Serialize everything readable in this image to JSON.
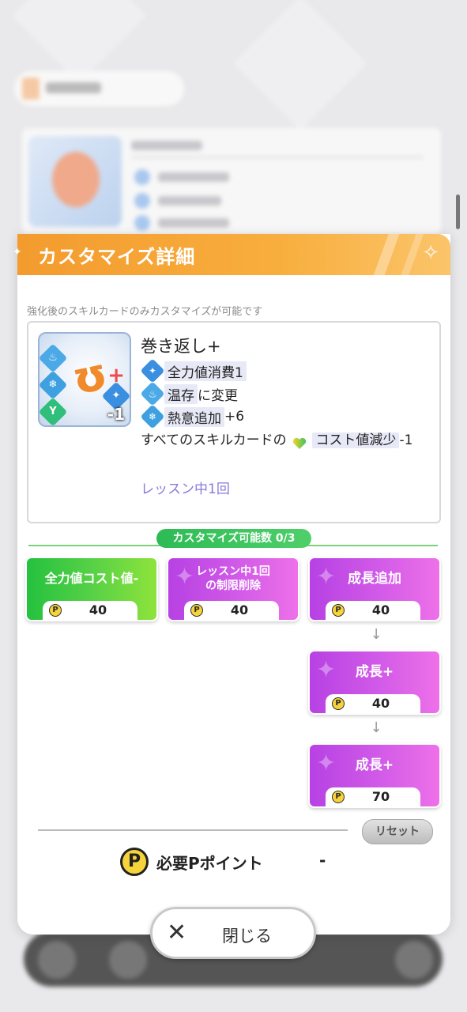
{
  "modal": {
    "title": "カスタマイズ詳細",
    "hint": "強化後のスキルカードのみカスタマイズが可能です",
    "card": {
      "name": "巻き返し+",
      "thumb_cost": "-1",
      "effects": [
        {
          "icon": "blue-diamond-icon",
          "text": "全力値消費1"
        },
        {
          "icon": "onsen-retain-icon",
          "text_highlight": "温存",
          "text_rest": "に変更"
        },
        {
          "icon": "heat-snowflake-icon",
          "text_highlight": "熱意追加",
          "text_rest": "+6"
        }
      ],
      "all_cards_prefix": "すべてのスキルカードの",
      "all_cards_highlight": "コスト値減少",
      "all_cards_suffix": "-1",
      "lesson_limit": "レッスン中1回"
    },
    "customize_count": "カスタマイズ可能数 0/3",
    "options": [
      {
        "label": "全力値コスト値-",
        "price": "40",
        "color": "green"
      },
      {
        "label": "レッスン中1回\nの制限削除",
        "price": "40",
        "color": "purple"
      },
      {
        "label": "成長追加",
        "price": "40",
        "color": "purple"
      },
      {
        "label": "成長+",
        "price": "40",
        "color": "purple"
      },
      {
        "label": "成長+",
        "price": "70",
        "color": "purple"
      }
    ],
    "arrows": [
      "↓",
      "↓"
    ],
    "reset_label": "リセット",
    "points_coin": "P",
    "points_label": "必要Pポイント",
    "points_value": "-"
  },
  "close_button": {
    "label": "閉じる",
    "icon": "close-icon"
  },
  "colors": {
    "header_orange": "#f39b2e",
    "green": "#25c13f",
    "purple": "#c24ee6",
    "lesson_text": "#8b7ad8"
  }
}
